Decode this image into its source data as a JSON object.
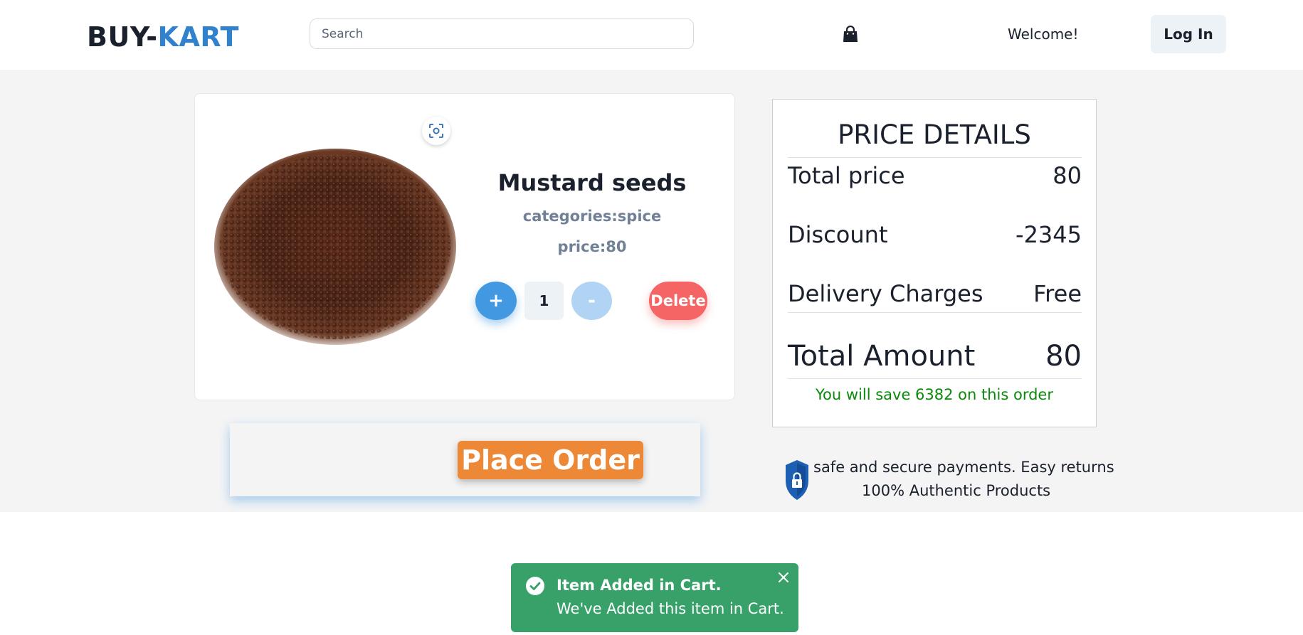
{
  "header": {
    "logo_part1": "BUY-",
    "logo_part2": "KART",
    "search_placeholder": "Search",
    "cart_icon": "shopping-bag-icon",
    "welcome": "Welcome!",
    "login_label": "Log In"
  },
  "cart_item": {
    "image_alt": "Mustard seeds",
    "scan_icon": "image-scan-icon",
    "name": "Mustard seeds",
    "categories": "categories:spice",
    "price": "price:80",
    "plus_label": "+",
    "quantity": "1",
    "minus_label": "-",
    "delete_label": "Delete"
  },
  "order": {
    "place_order_label": "Place Order"
  },
  "price_details": {
    "title": "PRICE DETAILS",
    "rows": [
      {
        "label": "Total price",
        "value": "80"
      },
      {
        "label": "Discount",
        "value": "-2345"
      },
      {
        "label": "Delivery Charges",
        "value": "Free"
      }
    ],
    "total_label": "Total Amount",
    "total_value": "80",
    "savings": "You will save 6382 on this order"
  },
  "trust": {
    "icon": "shield-lock-icon",
    "line1": "safe and secure payments. Easy returns",
    "line2": "100% Authentic Products"
  },
  "toast": {
    "icon": "check-circle-icon",
    "title": "Item Added in Cart.",
    "description": "We've Added this item in Cart.",
    "close_icon": "close-icon"
  },
  "colors": {
    "accent_blue": "#3182ce",
    "plus_blue": "#4299e1",
    "delete_red": "#f56565",
    "order_orange": "#ed8936",
    "toast_green": "#38a169",
    "savings_green": "#0a8a0a"
  }
}
